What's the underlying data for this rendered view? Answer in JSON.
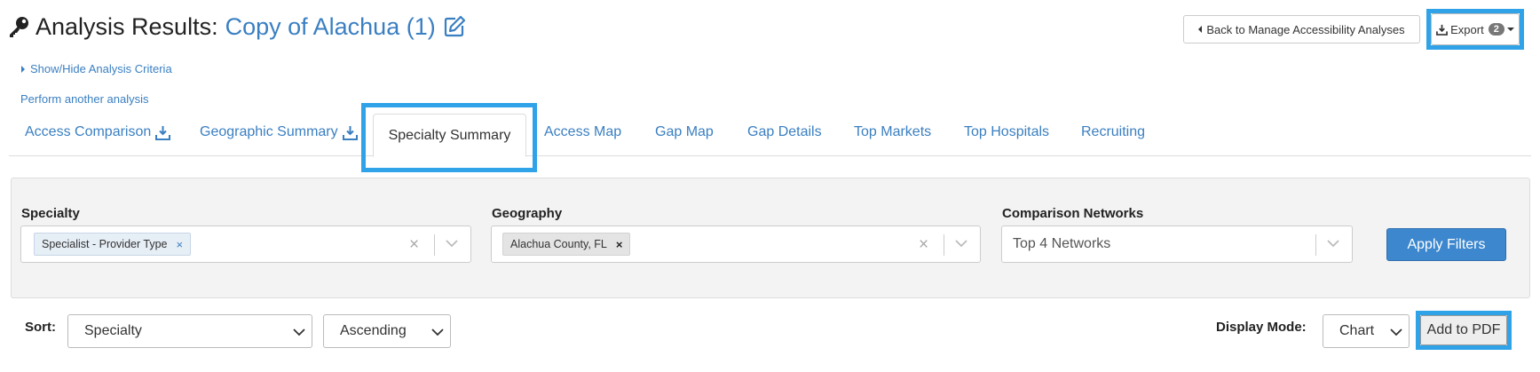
{
  "header": {
    "title_prefix": "Analysis Results:",
    "analysis_name": "Copy of Alachua (1)",
    "icons": {
      "title": "key-icon",
      "edit": "edit-icon"
    },
    "back_button": "Back to Manage Accessibility Analyses",
    "export_button": "Export",
    "export_count": "2"
  },
  "links": {
    "show_hide_criteria": "Show/Hide Analysis Criteria",
    "perform_another": "Perform another analysis"
  },
  "tabs": [
    {
      "label": "Access Comparison",
      "icon": "download-icon"
    },
    {
      "label": "Geographic Summary",
      "icon": "download-icon"
    },
    {
      "label": "Specialty Summary",
      "active": true
    },
    {
      "label": "Access Map"
    },
    {
      "label": "Gap Map"
    },
    {
      "label": "Gap Details"
    },
    {
      "label": "Top Markets"
    },
    {
      "label": "Top Hospitals"
    },
    {
      "label": "Recruiting"
    }
  ],
  "filters": {
    "specialty": {
      "label": "Specialty",
      "selected": "Specialist - Provider Type"
    },
    "geography": {
      "label": "Geography",
      "selected": "Alachua County, FL"
    },
    "networks": {
      "label": "Comparison Networks",
      "placeholder": "Top 4 Networks"
    },
    "apply_button": "Apply Filters"
  },
  "controls": {
    "sort_label": "Sort:",
    "sort_field": "Specialty",
    "sort_order": "Ascending",
    "display_mode_label": "Display Mode:",
    "display_mode": "Chart",
    "add_pdf_button": "Add to PDF"
  },
  "colors": {
    "link": "#3a7fc1",
    "highlight": "#30a3e8",
    "apply_button": "#3c87cd"
  }
}
